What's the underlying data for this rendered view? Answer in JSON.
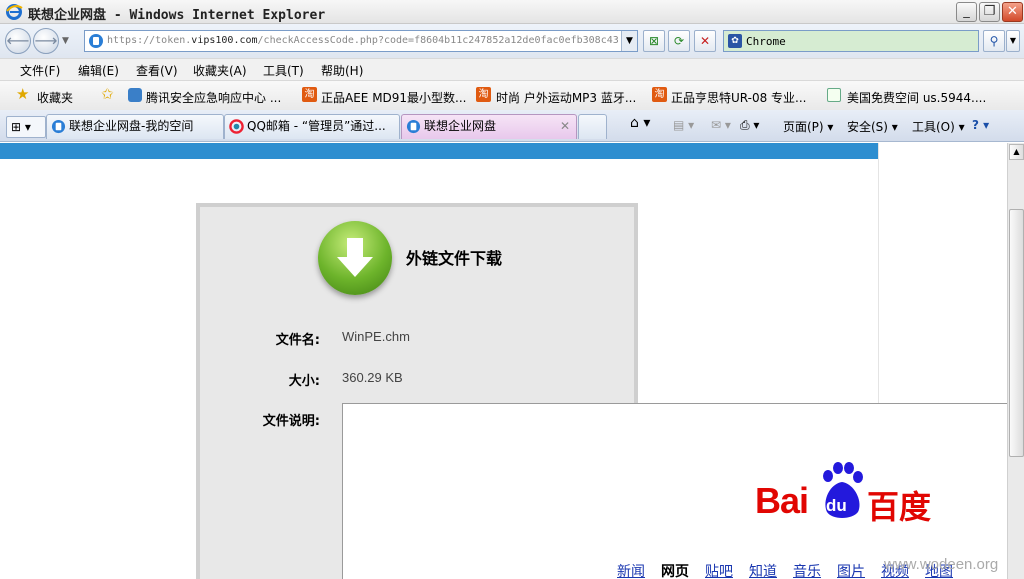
{
  "window": {
    "title": "联想企业网盘 - Windows Internet Explorer",
    "minimize": "_",
    "restore": "❐",
    "close": "✕"
  },
  "address": {
    "url_prefix": "https://token.",
    "url_domain": "vips100.com",
    "url_rest": "/checkAccessCode.php?code=f8604b11c247852a12de0fac0efb308c43",
    "search_text": "Chrome"
  },
  "menu": [
    "文件(F)",
    "编辑(E)",
    "查看(V)",
    "收藏夹(A)",
    "工具(T)",
    "帮助(H)"
  ],
  "favorites": {
    "label": "收藏夹",
    "items": [
      "腾讯安全应急响应中心 ...",
      "正品AEE MD91最小型数...",
      "时尚 户外运动MP3 蓝牙...",
      "正品亨思特UR-08 专业...",
      "美国免费空间 us.5944...."
    ]
  },
  "tabs": [
    {
      "label": "联想企业网盘-我的空间"
    },
    {
      "label": "QQ邮箱 - “管理员”通过..."
    },
    {
      "label": "联想企业网盘"
    }
  ],
  "commands": {
    "page": "页面(P)",
    "safety": "安全(S)",
    "tools": "工具(O)"
  },
  "download": {
    "title": "外链文件下载",
    "filename_label": "文件名:",
    "filename": "WinPE.chm",
    "size_label": "大小:",
    "size": "360.29 KB",
    "desc_label": "文件说明:"
  },
  "baidu": {
    "logo_left": "Bai",
    "logo_paw": "du",
    "logo_right": "百度",
    "links": [
      "新闻",
      "网页",
      "贴吧",
      "知道",
      "音乐",
      "图片",
      "视频",
      "地图"
    ],
    "current": "网页"
  },
  "watermark": "www.wodeen.org",
  "colors": {
    "accent_bar": "#2e8ed0",
    "download_green": "#6db42b",
    "baidu_red": "#e10602",
    "baidu_blue": "#2319dc"
  }
}
